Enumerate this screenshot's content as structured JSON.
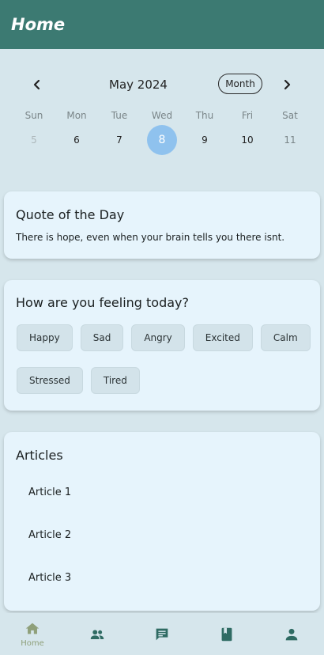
{
  "app": {
    "title": "Home"
  },
  "calendar": {
    "month_label": "May 2024",
    "prev_icon": "chevron-left-icon",
    "next_icon": "chevron-right-icon",
    "view_toggle": "Month",
    "weekdays": [
      "Sun",
      "Mon",
      "Tue",
      "Wed",
      "Thu",
      "Fri",
      "Sat"
    ],
    "dates": [
      "5",
      "6",
      "7",
      "8",
      "9",
      "10",
      "11"
    ],
    "selected_date": "8",
    "selected_color": "#8fc2ee"
  },
  "quote": {
    "title": "Quote of the Day",
    "text": "There is hope, even when your brain tells you there isnt."
  },
  "feeling": {
    "title": "How are you feeling today?",
    "moods_row1": [
      "Happy",
      "Sad",
      "Angry",
      "Excited",
      "Calm"
    ],
    "moods_row2": [
      "Stressed",
      "Tired"
    ]
  },
  "articles": {
    "title": "Articles",
    "items": [
      "Article 1",
      "Article 2",
      "Article 3"
    ]
  },
  "bottom_nav": {
    "items": [
      {
        "icon": "home-icon",
        "label": "Home",
        "active": true
      },
      {
        "icon": "people-icon",
        "label": "",
        "active": false
      },
      {
        "icon": "chat-icon",
        "label": "",
        "active": false
      },
      {
        "icon": "book-icon",
        "label": "",
        "active": false
      },
      {
        "icon": "person-icon",
        "label": "",
        "active": false
      }
    ]
  },
  "colors": {
    "app_bar": "#3c7a72",
    "background": "#d6e6ec",
    "card": "#e6f4fc",
    "nav_icon": "#2f6b63",
    "nav_active": "#8fa07a"
  }
}
